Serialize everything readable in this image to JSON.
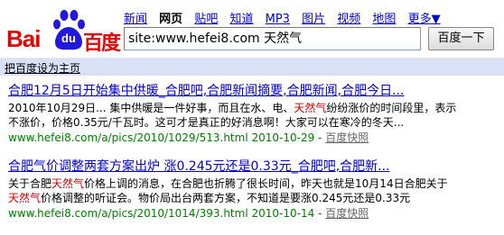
{
  "logo": {
    "latin": "Bai",
    "badge": "du",
    "chinese": "百度"
  },
  "nav": [
    {
      "label": "新闻",
      "active": false
    },
    {
      "label": "网页",
      "active": true
    },
    {
      "label": "贴吧",
      "active": false
    },
    {
      "label": "知道",
      "active": false
    },
    {
      "label": "MP3",
      "active": false
    },
    {
      "label": "图片",
      "active": false
    },
    {
      "label": "视频",
      "active": false
    },
    {
      "label": "地图",
      "active": false
    },
    {
      "label": "更多▼",
      "active": false
    }
  ],
  "search": {
    "value": "site:www.hefei8.com 天然气",
    "button": "百度一下"
  },
  "home_link": "把百度设为主页",
  "results": [
    {
      "title": "合肥12月5日开始集中供暖_合肥吧,合肥新闻摘要,合肥新闻,合肥今日...",
      "snippet_line1_pre": "2010年10月29日... 集中供暖是一件好事，而且在水、电、",
      "snippet_line1_hl": "天然气",
      "snippet_line1_post": "纷纷涨价的时间段里，表示",
      "snippet_line2": "不涨价，价格0.35元/千瓦时。这可才是真正的好消息啊！大家可以在寒冷的冬天...",
      "url": "www.hefei8.com/a/pics/2010/1029/513.html 2010-10-29 - ",
      "cache": "百度快照"
    },
    {
      "title": "合肥气价调整两套方案出炉 涨0.245元还是0.33元_合肥吧,合肥新...",
      "snippet_line1_pre": "关于合肥",
      "snippet_line1_hl": "天然气",
      "snippet_line1_post": "价格上调的消息，在合肥也折腾了很长时间，昨天也就是10月14日合肥关于",
      "snippet_line2_hl": "天然气",
      "snippet_line2_post": "价格调整的听证会。物价局出台两套方案，不知道是要涨0.245元还是0.33元",
      "url": "www.hefei8.com/a/pics/2010/1014/393.html 2010-10-14 - ",
      "cache": "百度快照"
    }
  ],
  "colors": {
    "brand_red": "#e10602",
    "brand_blue": "#2319dc",
    "link": "#0000cc",
    "url_green": "#008000",
    "highlight": "#cc0000",
    "bar": "#d9e1f7"
  }
}
